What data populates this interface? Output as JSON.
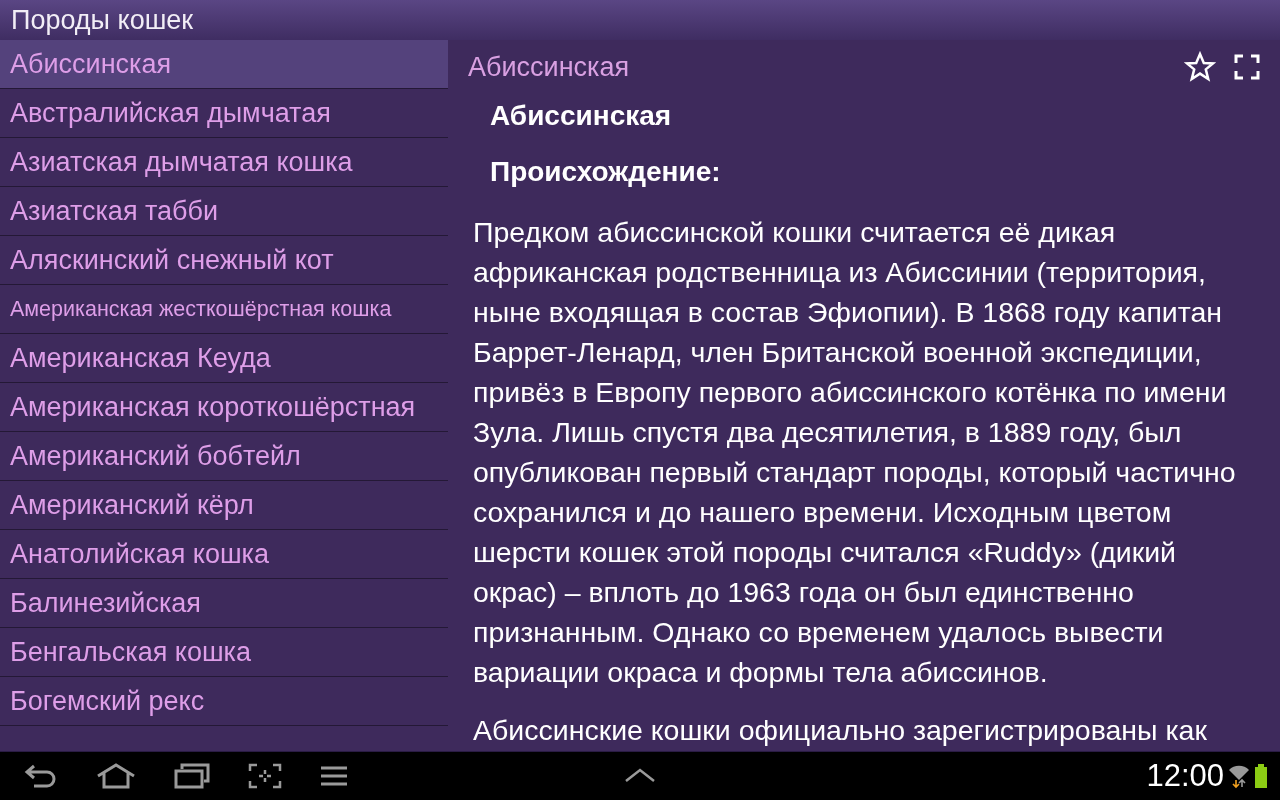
{
  "app_bar": {
    "title": "Породы кошек"
  },
  "breeds": [
    {
      "label": "Абиссинская",
      "selected": true
    },
    {
      "label": "Австралийская дымчатая",
      "selected": false
    },
    {
      "label": "Азиатская дымчатая кошка",
      "selected": false
    },
    {
      "label": "Азиатская табби",
      "selected": false
    },
    {
      "label": "Аляскинский снежный кот",
      "selected": false
    },
    {
      "label": "Американская жесткошёрстная кошка",
      "selected": false
    },
    {
      "label": "Американская Кеуда",
      "selected": false
    },
    {
      "label": "Американская короткошёрстная",
      "selected": false
    },
    {
      "label": "Американский бобтейл",
      "selected": false
    },
    {
      "label": "Американский кёрл",
      "selected": false
    },
    {
      "label": "Анатолийская кошка",
      "selected": false
    },
    {
      "label": "Балинезийская",
      "selected": false
    },
    {
      "label": "Бенгальская кошка",
      "selected": false
    },
    {
      "label": "Богемский рекс",
      "selected": false
    }
  ],
  "detail": {
    "title": "Абиссинская",
    "article": [
      {
        "kind": "heading",
        "text": "Абиссинская"
      },
      {
        "kind": "heading",
        "text": "Происхождение:"
      },
      {
        "kind": "paragraph",
        "text": "Предком абиссинской кошки считается её дикая африканская родственница из Абиссинии (территория, ныне входящая в состав Эфиопии). В 1868 году капитан Баррет-Ленард, член Британской военной экспедиции, привёз в Европу первого абиссинского котёнка по имени Зула. Лишь спустя два десятилетия, в 1889 году, был опубликован первый стандарт породы, который частично сохранился и до нашего времени. Исходным цветом шерсти кошек этой породы считался «Ruddy» (дикий окрас) – вплоть до 1963 года он был единственно признанным. Однако со временем удалось вывести вариации окраса и формы тела абиссинов."
      },
      {
        "kind": "paragraph",
        "text": "Абиссинские кошки официально зарегистрированы как"
      }
    ]
  },
  "status_bar": {
    "time": "12:00"
  }
}
